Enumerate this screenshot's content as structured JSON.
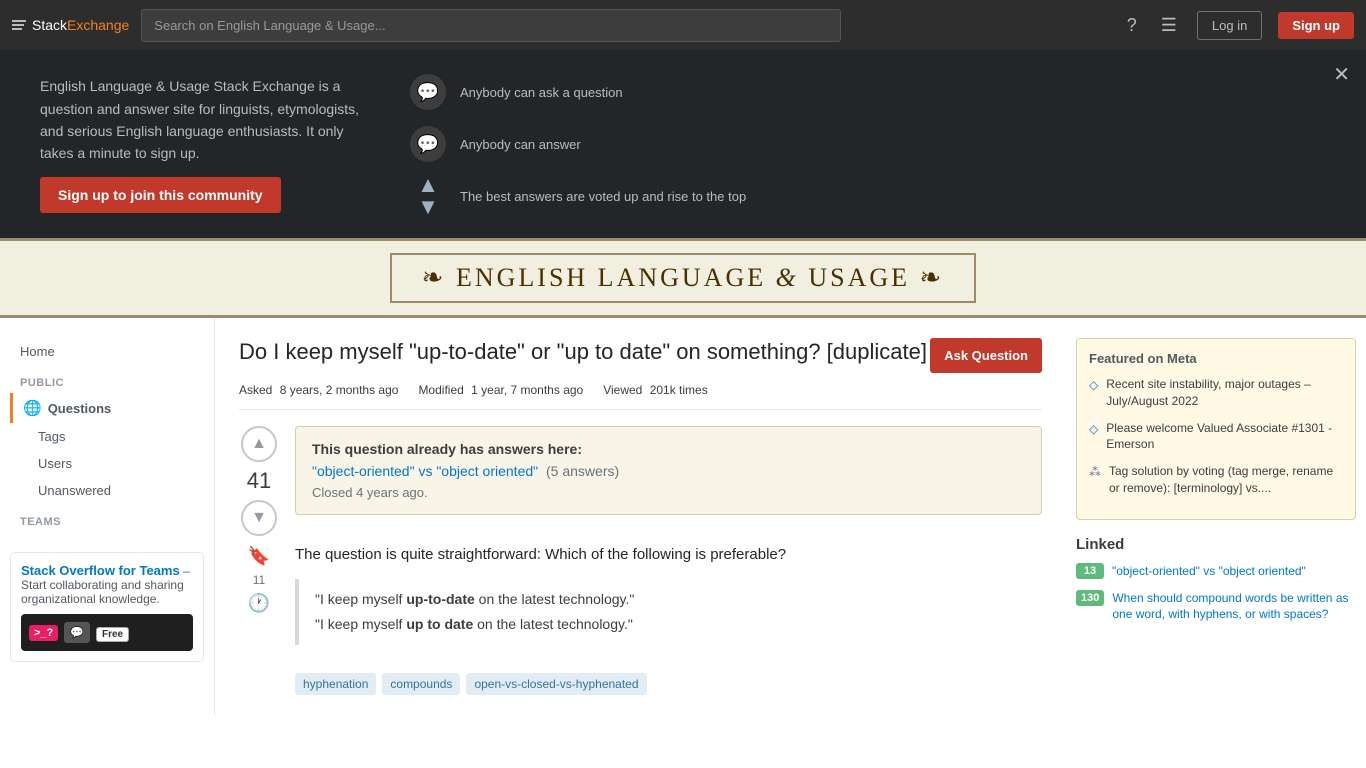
{
  "topnav": {
    "logo_text": "Stack",
    "logo_exchange": "Exchange",
    "search_placeholder": "Search on English Language & Usage...",
    "help_icon": "?",
    "inbox_icon": "☰",
    "login_label": "Log in",
    "signup_label": "Sign up"
  },
  "banner": {
    "description": "English Language & Usage Stack Exchange is a question and answer site for linguists, etymologists, and serious English language enthusiasts. It only takes a minute to sign up.",
    "join_button": "Sign up to join this community",
    "features": [
      {
        "icon": "💬",
        "text": "Anybody can ask a question"
      },
      {
        "icon": "💬",
        "text": "Anybody can answer"
      },
      {
        "vote_icon": true,
        "text": "The best answers are voted up and rise to the top"
      }
    ]
  },
  "site_header": {
    "title": "ENGLISH LANGUAGE",
    "ampersand": "&",
    "title2": "USAGE"
  },
  "sidebar": {
    "home": "Home",
    "public_label": "PUBLIC",
    "questions_label": "Questions",
    "tags_label": "Tags",
    "users_label": "Users",
    "unanswered_label": "Unanswered",
    "teams_label": "TEAMS",
    "teams_title": "Stack Overflow for Teams",
    "teams_desc": "– Start collaborating and sharing organizational knowledge.",
    "free_badge": "Free"
  },
  "question": {
    "title": "Do I keep myself \"up-to-date\" or \"up to date\" on something? [duplicate]",
    "ask_button": "Ask Question",
    "asked_label": "Asked",
    "asked_value": "8 years, 2 months ago",
    "modified_label": "Modified",
    "modified_value": "1 year, 7 months ago",
    "viewed_label": "Viewed",
    "viewed_value": "201k times",
    "vote_up": "▲",
    "vote_down": "▼",
    "vote_count": "41",
    "bookmark_count": "11",
    "duplicate_title": "This question already has answers here:",
    "duplicate_link": "\"object-oriented\" vs \"object oriented\"",
    "duplicate_answers": "(5 answers)",
    "closed_note": "Closed 4 years ago.",
    "body_text": "The question is quite straightforward: Which of the following is preferable?",
    "quote1": "\"I keep myself up-to-date on the latest technology.\"",
    "quote2": "\"I keep myself up to date on the latest technology.\"",
    "quote1_bold": "up-to-date",
    "quote2_bold": "up to date",
    "tags": [
      "hyphenation",
      "compounds",
      "open-vs-closed-vs-hyphenated"
    ]
  },
  "featured_meta": {
    "title": "Featured on Meta",
    "items": [
      {
        "icon": "diamond",
        "text": "Recent site instability, major outages – July/August 2022"
      },
      {
        "icon": "diamond",
        "text": "Please welcome Valued Associate #1301 - Emerson"
      },
      {
        "icon": "special",
        "text": "Tag solution by voting (tag merge, rename or remove): [terminology] vs...."
      }
    ]
  },
  "linked": {
    "title": "Linked",
    "items": [
      {
        "score": "13",
        "text": "\"object-oriented\" vs \"object oriented\""
      },
      {
        "score": "130",
        "text": "When should compound words be written as one word, with hyphens, or with spaces?"
      }
    ]
  }
}
